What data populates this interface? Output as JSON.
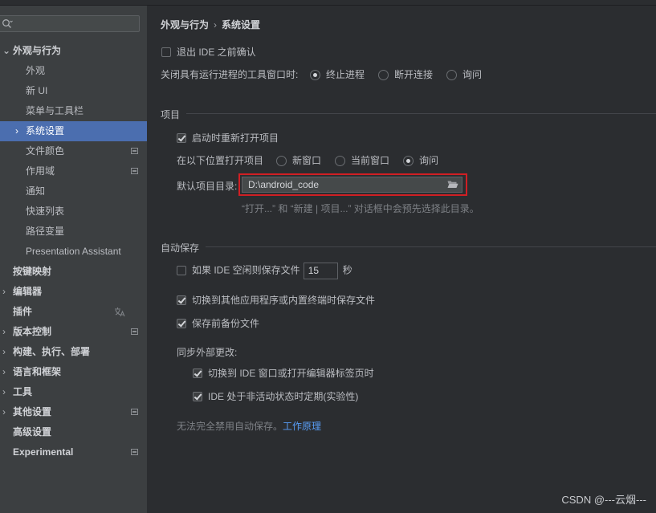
{
  "sidebar": {
    "search_placeholder": "",
    "items": [
      {
        "label": "外观与行为",
        "bold": true,
        "chevron": "⌄"
      },
      {
        "label": "外观"
      },
      {
        "label": "新 UI"
      },
      {
        "label": "菜单与工具栏"
      },
      {
        "label": "系统设置",
        "chevron": "›",
        "selected": true
      },
      {
        "label": "文件颜色"
      },
      {
        "label": "作用域"
      },
      {
        "label": "通知"
      },
      {
        "label": "快速列表"
      },
      {
        "label": "路径变量"
      },
      {
        "label": "Presentation Assistant"
      },
      {
        "label": "按键映射"
      },
      {
        "label": "编辑器",
        "chevron": "›"
      },
      {
        "label": "插件"
      },
      {
        "label": "版本控制",
        "chevron": "›"
      },
      {
        "label": "构建、执行、部署",
        "chevron": "›"
      },
      {
        "label": "语言和框架",
        "chevron": "›"
      },
      {
        "label": "工具",
        "chevron": "›"
      },
      {
        "label": "其他设置",
        "chevron": "›"
      },
      {
        "label": "高级设置"
      },
      {
        "label": "Experimental"
      }
    ],
    "plugin_icon": "translate-icon"
  },
  "breadcrumb": {
    "parent": "外观与行为",
    "separator": "›",
    "current": "系统设置"
  },
  "general": {
    "confirm_exit": "退出 IDE 之前确认",
    "close_tool_label": "关闭具有运行进程的工具窗口时:",
    "close_options": [
      "终止进程",
      "断开连接",
      "询问"
    ],
    "close_selected": "终止进程"
  },
  "project": {
    "section": "项目",
    "reopen": "启动时重新打开项目",
    "open_in_label": "在以下位置打开项目",
    "open_options": [
      "新窗口",
      "当前窗口",
      "询问"
    ],
    "open_selected": "询问",
    "default_dir_label": "默认项目目录:",
    "default_dir_value": "D:\\android_code",
    "hint": "“打开...” 和 “新建 | 项目...” 对话框中会预先选择此目录。"
  },
  "autosave": {
    "section": "自动保存",
    "idle_prefix": "如果 IDE 空闲则保存文件",
    "idle_seconds": "15",
    "idle_unit": "秒",
    "switch_save": "切换到其他应用程序或内置终端时保存文件",
    "backup": "保存前备份文件",
    "sync_label": "同步外部更改:",
    "sync_switch": "切换到 IDE 窗口或打开编辑器标签页时",
    "sync_periodic": "IDE 处于非活动状态时定期(实验性)",
    "note_prefix": "无法完全禁用自动保存。",
    "note_link": "工作原理"
  },
  "watermark": "CSDN @---云烟---",
  "colors": {
    "selection": "#4b6eaf",
    "highlight_border": "#d01f24",
    "link": "#589df6"
  }
}
